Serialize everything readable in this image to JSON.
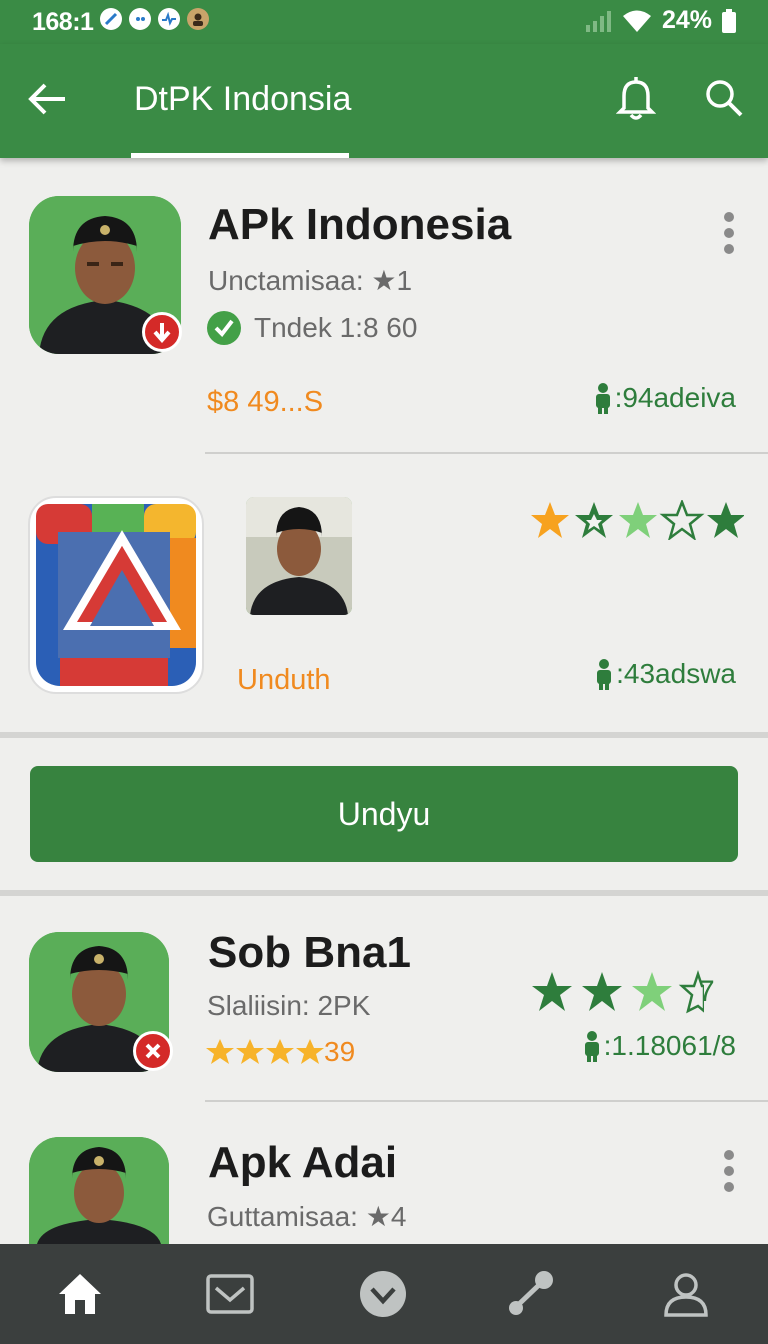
{
  "status_bar": {
    "time": "168:1",
    "battery": "24%"
  },
  "app_bar": {
    "title": "DtPK Indonsia"
  },
  "icons": {
    "back": "back-arrow-icon",
    "bell": "bell-icon",
    "search": "search-icon"
  },
  "items": [
    {
      "title": "APk Indonesia",
      "subtitle": "Unctamisaa: ★1",
      "verified": "Tndek 1:8 60",
      "price": "$8 49...S",
      "downloads": ":94adeiva"
    },
    {
      "label": "Unduth",
      "downloads": ":43adswa",
      "rating": 2.5
    },
    {
      "title": "Sob Bna1",
      "subtitle": "Slaliisin: 2PK",
      "stars_text": "39",
      "rating_num": "7",
      "downloads": ":1.18061/8"
    },
    {
      "title": "Apk Adai",
      "subtitle": "Guttamisaa: ★4"
    }
  ],
  "download_button": {
    "label": "Undyu"
  },
  "colors": {
    "primary": "#3a8b45",
    "accent": "#f08a1f",
    "nav": "#3b3f3e"
  }
}
